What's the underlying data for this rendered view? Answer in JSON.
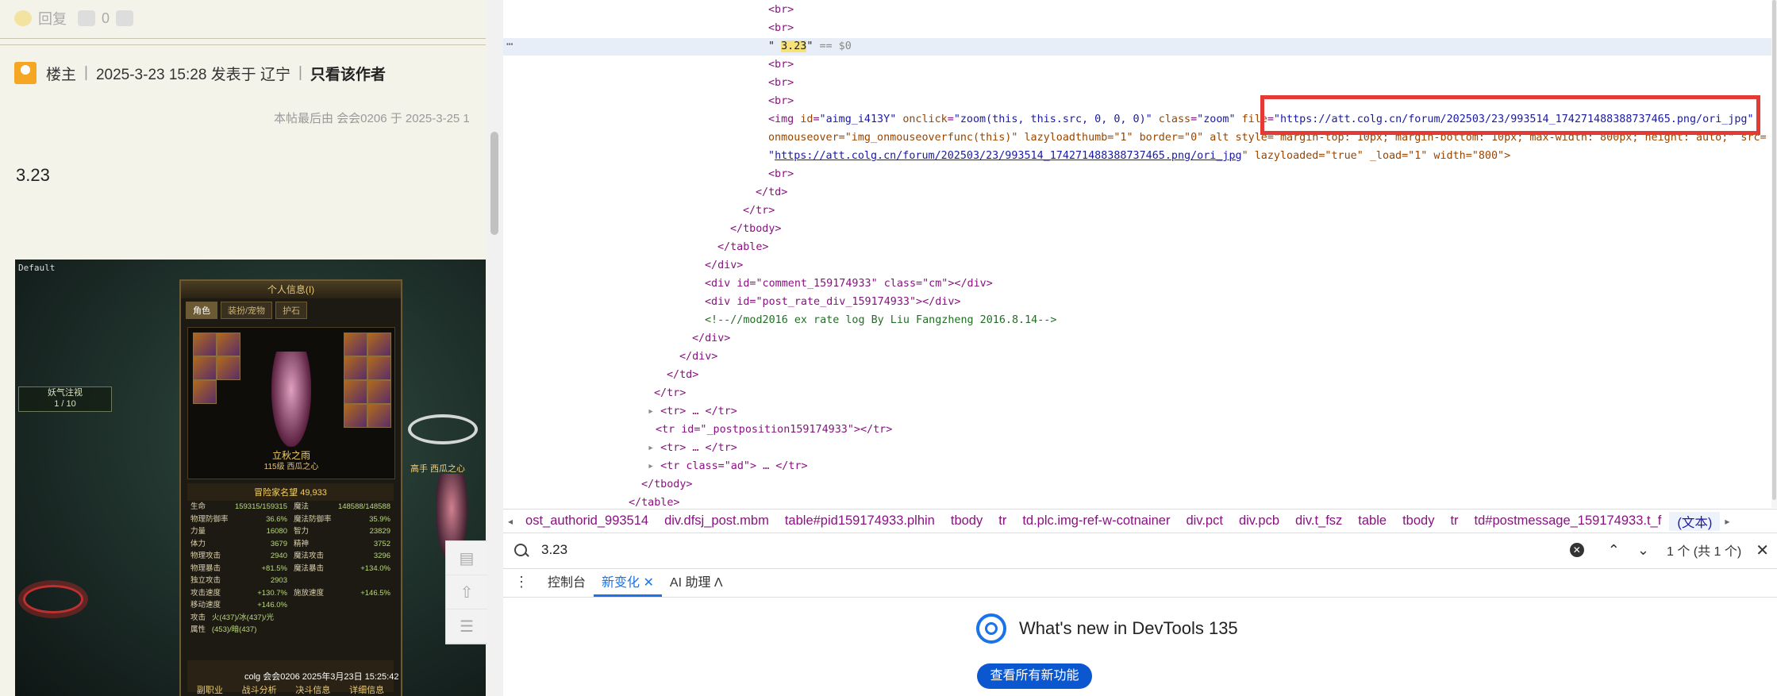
{
  "post": {
    "reply_label": "回复",
    "like_count": "0",
    "author_role": "楼主",
    "posted_info": "2025-3-23 15:28 发表于 辽宁",
    "only_author": "只看该作者",
    "edit_note": "本帖最后由 会会0206 于 2025-3-25 1",
    "body_text": "3.23"
  },
  "game": {
    "default_label": "Default",
    "panel_title": "个人信息(I)",
    "tabs": [
      "角色",
      "装扮/宠物",
      "护石"
    ],
    "char_name": "立秋之雨",
    "char_sub": "115级 西瓜之心",
    "fame": "冒险家名望 49,933",
    "buff_name": "妖气注视",
    "buff_count": "1 / 10",
    "side_label": "高手 西瓜之心",
    "chat_line": "colg 会会0206 2025年3月23日 15:25:42",
    "bottom_buttons": [
      "副职业",
      "战斗分析",
      "决斗信息",
      "详细信息"
    ],
    "stats": [
      [
        [
          "生命",
          "159315/159315"
        ],
        [
          "魔法",
          "148588/148588"
        ]
      ],
      [
        [
          "物理防御率",
          "36.6%"
        ],
        [
          "魔法防御率",
          "35.9%"
        ]
      ],
      [
        [
          "力量",
          "16080"
        ],
        [
          "智力",
          "23829"
        ]
      ],
      [
        [
          "体力",
          "3679"
        ],
        [
          "精神",
          "3752"
        ]
      ],
      [
        [
          "物理攻击",
          "2940"
        ],
        [
          "魔法攻击",
          "3296"
        ]
      ],
      [
        [
          "物理暴击",
          "+81.5%"
        ],
        [
          "魔法暴击",
          "+134.0%"
        ]
      ],
      [
        [
          "独立攻击",
          "2903"
        ],
        [
          "",
          ""
        ]
      ],
      [
        [
          "攻击速度",
          "+130.7%"
        ],
        [
          "施放速度",
          "+146.5%"
        ]
      ],
      [
        [
          "移动速度",
          "+146.0%"
        ],
        [
          "",
          ""
        ]
      ],
      [
        [
          "攻击属性",
          "火(437)/冰(437)/光(453)/暗(437)"
        ],
        [
          "",
          ""
        ]
      ]
    ]
  },
  "devtools": {
    "breadcrumbs": [
      "ost_authorid_993514",
      "div.dfsj_post.mbm",
      "table#pid159174933.plhin",
      "tbody",
      "tr",
      "td.plc.img-ref-w-cotnainer",
      "div.pct",
      "div.pcb",
      "div.t_fsz",
      "table",
      "tbody",
      "tr",
      "td#postmessage_159174933.t_f",
      "(文本)"
    ],
    "search_value": "3.23",
    "match_count": "1 个 (共 1 个)",
    "tabs": [
      "控制台",
      "新变化",
      "AI 助理"
    ],
    "whats_new_title": "What's new in DevTools 135",
    "whats_new_button": "查看所有新功能",
    "code": {
      "br": "<br>",
      "text_q_open": "\"",
      "text_val": "3.23",
      "text_q_close": "\"",
      "eq_dollar": "== $0",
      "img_open": "<img",
      "img_id": "aimg_i413Y",
      "img_onclick": "zoom(this, this.src, 0, 0, 0)",
      "img_class": "zoom",
      "img_file": "https://att.colg.cn/forum/202503/23/993514_174271488388737465.png/ori_jpg",
      "img_line2": "onmouseover=\"img_onmouseoverfunc(this)\" lazyloadthumb=\"1\" border=\"0\" alt style=\"margin-top: 10px; margin-bottom: 10px; max-width: 800px; height: auto;\" src=",
      "img_src": "https://att.colg.cn/forum/202503/23/993514_174271488388737465.png/ori_jpg",
      "img_line3_rest": "\" lazyloaded=\"true\" _load=\"1\" width=\"800\">",
      "close_td": "</td>",
      "close_tr": "</tr>",
      "close_tbody": "</tbody>",
      "close_table": "</table>",
      "close_div": "</div>",
      "comment_div": "<div id=\"comment_159174933\" class=\"cm\"></div>",
      "rate_div": "<div id=\"post_rate_div_159174933\"></div>",
      "comment": "<!--//mod2016 ex rate log By Liu Fangzheng 2016.8.14-->",
      "tr_collapsed": "<tr> … </tr>",
      "tr_postposition": "<tr id=\"_postposition159174933\"></tr>",
      "tr_ad": "<tr class=\"ad\"> … </tr>",
      "ellipsis": "…"
    }
  }
}
